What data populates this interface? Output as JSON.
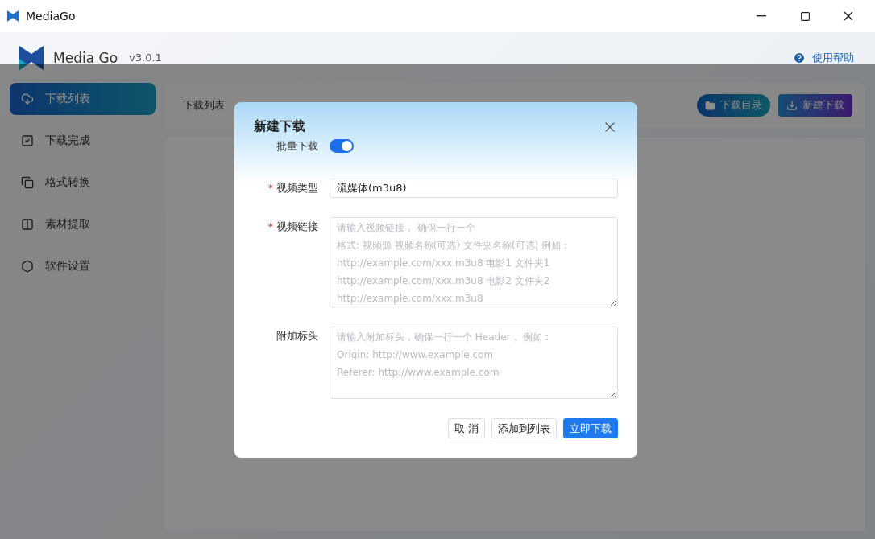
{
  "window": {
    "title": "MediaGo"
  },
  "app": {
    "name": "Media Go",
    "version": "v3.0.1",
    "help": "使用帮助"
  },
  "sidebar": {
    "items": [
      {
        "label": "下载列表",
        "selected": true
      },
      {
        "label": "下载完成",
        "selected": false
      },
      {
        "label": "格式转换",
        "selected": false
      },
      {
        "label": "素材提取",
        "selected": false
      },
      {
        "label": "软件设置",
        "selected": false
      }
    ]
  },
  "header": {
    "title": "下载列表",
    "buttons": [
      "下载目录",
      "新建下载"
    ]
  },
  "dialog": {
    "title": "新建下载",
    "batch": {
      "label": "批量下载",
      "on": true
    },
    "fields": [
      {
        "kind": "select",
        "marker": "*",
        "label": "视频类型",
        "value": "流媒体(m3u8)"
      },
      {
        "kind": "textarea",
        "marker": "*",
        "label": "视频链接",
        "placeholder": [
          "请输入视频链接， 确保一行一个",
          "格式: 视频源 视频名称(可选) 文件夹名称(可选) 例如：",
          "http://example.com/xxx.m3u8 电影1 文件夹1",
          "http://example.com/xxx.m3u8 电影2 文件夹2",
          "http://example.com/xxx.m3u8"
        ]
      },
      {
        "kind": "textarea",
        "label": "附加标头",
        "placeholder": [
          "请输入附加标头，确保一行一个 Header， 例如：",
          "Origin: http://www.example.com",
          "Referer: http://www.example.com"
        ]
      }
    ],
    "buttons": [
      {
        "kind": "default",
        "label": "取 消"
      },
      {
        "kind": "default",
        "label": "添加到列表"
      },
      {
        "kind": "primary",
        "label": "立即下载"
      }
    ]
  }
}
